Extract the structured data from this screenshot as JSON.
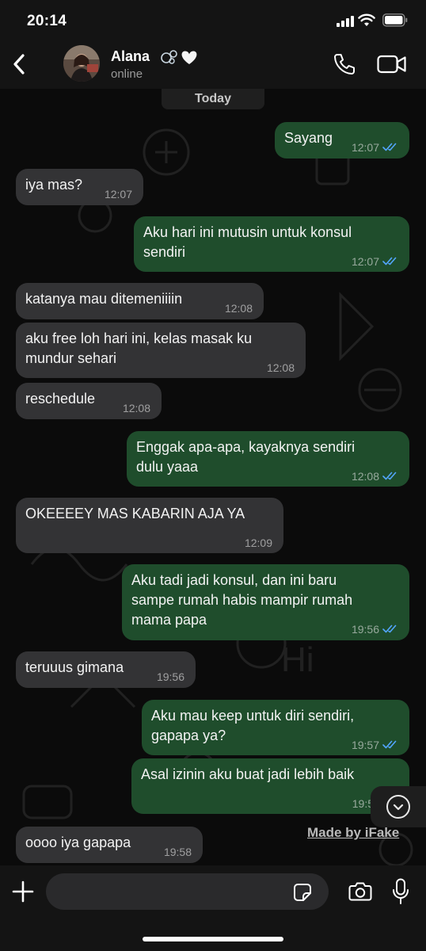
{
  "status_bar": {
    "time": "20:14"
  },
  "header": {
    "contact_name": "Alana",
    "contact_status": "online"
  },
  "chat": {
    "date_divider": "Today",
    "messages": [
      {
        "direction": "out",
        "text": "Sayang",
        "time": "12:07",
        "read": true
      },
      {
        "direction": "in",
        "text": "iya mas?",
        "time": "12:07"
      },
      {
        "direction": "out",
        "text": "Aku hari ini mutusin untuk konsul\nsendiri",
        "time": "12:07",
        "read": true
      },
      {
        "direction": "in",
        "text": "katanya mau ditemeniiiin",
        "time": "12:08"
      },
      {
        "direction": "in",
        "text": "aku free loh hari ini, kelas masak ku\nmundur sehari",
        "time": "12:08"
      },
      {
        "direction": "in",
        "text": "reschedule",
        "time": "12:08"
      },
      {
        "direction": "out",
        "text": "Enggak apa-apa, kayaknya sendiri\ndulu yaaa",
        "time": "12:08",
        "read": true
      },
      {
        "direction": "in",
        "text": "OKEEEEY MAS KABARIN AJA YA",
        "time": "12:09"
      },
      {
        "direction": "out",
        "text": "Aku tadi jadi konsul, dan ini baru\nsampe rumah habis mampir rumah\nmama papa",
        "time": "19:56",
        "read": true
      },
      {
        "direction": "in",
        "text": "teruuus gimana",
        "time": "19:56"
      },
      {
        "direction": "out",
        "text": "Aku mau keep untuk diri sendiri,\ngapapa ya?",
        "time": "19:57",
        "read": true
      },
      {
        "direction": "out",
        "text": "Asal izinin aku buat jadi lebih baik",
        "time": "19:5",
        "read": true
      },
      {
        "direction": "in",
        "text": "oooo iya gapapa",
        "time": "19:58"
      }
    ],
    "watermark": "Made by iFake"
  },
  "input_bar": {
    "placeholder": "",
    "value": ""
  },
  "colors": {
    "outgoing_bubble": "#1f4d2c",
    "incoming_bubble": "#333335",
    "read_ticks": "#53a6ff",
    "background": "#0b0b0b"
  },
  "icons": [
    "back-chevron-icon",
    "phone-icon",
    "video-camera-icon",
    "chevron-down-icon",
    "plus-icon",
    "sticker-icon",
    "camera-icon",
    "microphone-icon",
    "double-check-icon"
  ]
}
